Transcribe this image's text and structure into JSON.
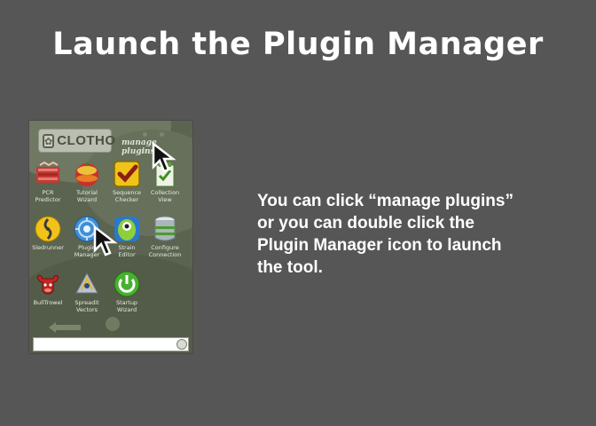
{
  "slide": {
    "title": "Launch the Plugin Manager",
    "instruction": "You can click “manage plugins” or you can double click the Plugin Manager icon to launch the tool."
  },
  "app": {
    "logo_text": "CLOTHO",
    "manage_plugins_link": "manage plugins",
    "search": {
      "value": "",
      "placeholder": ""
    },
    "icons": [
      {
        "id": "pcr-predictor",
        "label1": "PCR",
        "label2": "Predictor",
        "icon": "pcr-predictor-icon"
      },
      {
        "id": "tutorial-wizard",
        "label1": "Tutorial",
        "label2": "Wizard",
        "icon": "tutorial-wizard-icon"
      },
      {
        "id": "sequence-checker",
        "label1": "Sequence",
        "label2": "Checker",
        "icon": "sequence-checker-icon"
      },
      {
        "id": "collection-view",
        "label1": "Collection",
        "label2": "View",
        "icon": "collection-view-icon"
      },
      {
        "id": "sledrunner",
        "label1": "Sledrunner",
        "label2": "",
        "icon": "sledrunner-icon"
      },
      {
        "id": "plugin-manager",
        "label1": "Plugin",
        "label2": "Manager",
        "icon": "plugin-manager-icon"
      },
      {
        "id": "strain-editor",
        "label1": "Strain",
        "label2": "Editor",
        "icon": "strain-editor-icon"
      },
      {
        "id": "configure-connection",
        "label1": "Configure",
        "label2": "Connection",
        "icon": "configure-connection-icon"
      },
      {
        "id": "bulltrowel",
        "label1": "BullTrowel",
        "label2": "",
        "icon": "bulltrowel-icon"
      },
      {
        "id": "spreadit-vectors",
        "label1": "Spreadit",
        "label2": "Vectors",
        "icon": "spreadit-vectors-icon"
      },
      {
        "id": "startup-wizard",
        "label1": "Startup",
        "label2": "Wizard",
        "icon": "startup-wizard-icon"
      }
    ]
  },
  "colors": {
    "background": "#565656",
    "app_panel": "#5b6450",
    "text": "#ffffff"
  }
}
